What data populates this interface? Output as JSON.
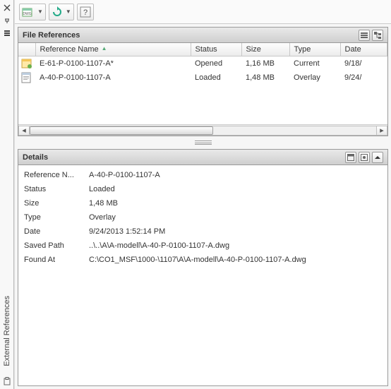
{
  "palette_title": "External References",
  "toolbar": {
    "attach_tooltip": "Attach",
    "refresh_tooltip": "Refresh",
    "help_tooltip": "Help"
  },
  "file_refs": {
    "header": "File References",
    "columns": {
      "name": "Reference Name",
      "status": "Status",
      "size": "Size",
      "type": "Type",
      "date": "Date"
    },
    "rows": [
      {
        "icon": "dwg-current",
        "name": "E-61-P-0100-1107-A*",
        "status": "Opened",
        "size": "1,16 MB",
        "type": "Current",
        "date": "9/18/"
      },
      {
        "icon": "dwg-overlay",
        "name": "A-40-P-0100-1107-A",
        "status": "Loaded",
        "size": "1,48 MB",
        "type": "Overlay",
        "date": "9/24/"
      }
    ]
  },
  "details": {
    "header": "Details",
    "rows": [
      {
        "k": "Reference N...",
        "v": "A-40-P-0100-1107-A"
      },
      {
        "k": "Status",
        "v": "Loaded"
      },
      {
        "k": "Size",
        "v": "1,48 MB"
      },
      {
        "k": "Type",
        "v": "Overlay"
      },
      {
        "k": "Date",
        "v": "9/24/2013 1:52:14 PM"
      },
      {
        "k": "Saved Path",
        "v": "..\\..\\A\\A-modell\\A-40-P-0100-1107-A.dwg"
      },
      {
        "k": "Found At",
        "v": "C:\\CO1_MSF\\1000-\\1107\\A\\A-modell\\A-40-P-0100-1107-A.dwg"
      }
    ]
  }
}
